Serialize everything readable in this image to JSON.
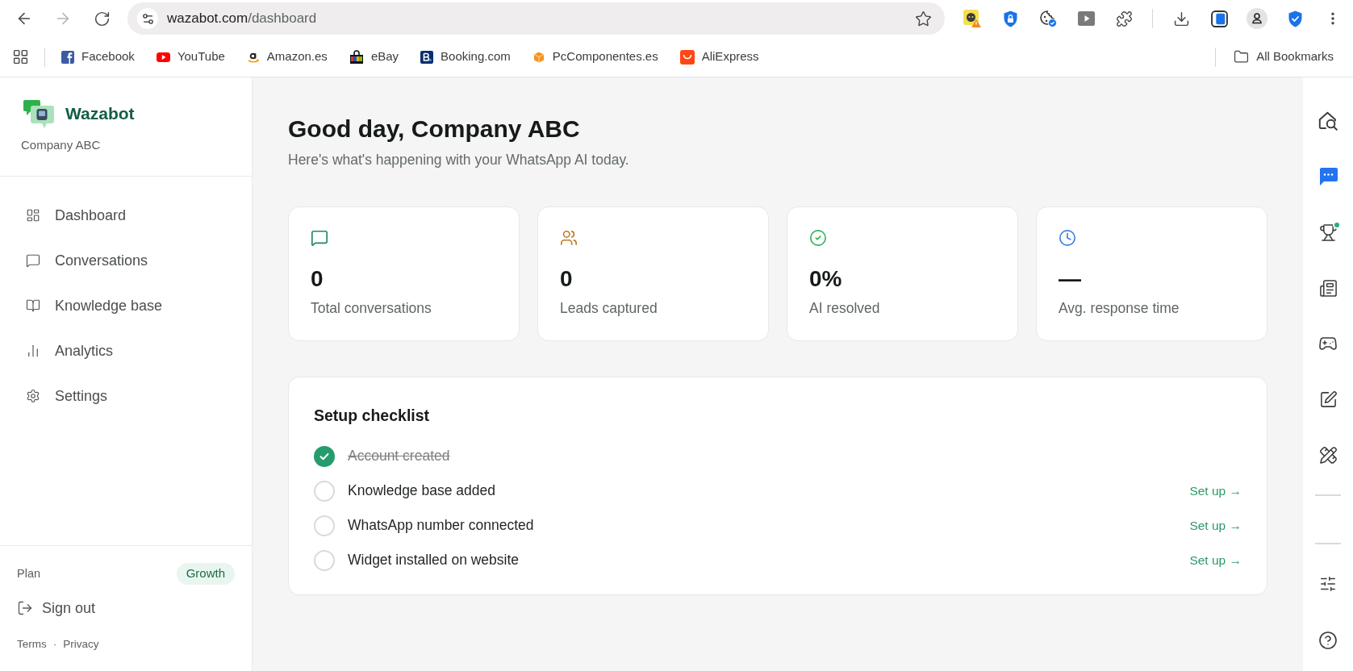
{
  "browser": {
    "forward_disabled": true,
    "url": {
      "host": "wazabot.com",
      "path": "/dashboard"
    },
    "bookmarks": [
      {
        "label": "Facebook",
        "kind": "fsquare"
      },
      {
        "label": "YouTube",
        "kind": "play"
      },
      {
        "label": "Amazon.es",
        "kind": "smile"
      },
      {
        "label": "eBay",
        "kind": "bag"
      },
      {
        "label": "Booking.com",
        "kind": "bsquare"
      },
      {
        "label": "PcComponentes.es",
        "kind": "cube"
      },
      {
        "label": "AliExpress",
        "kind": "tray"
      }
    ],
    "all_bookmarks": "All Bookmarks"
  },
  "sidebar": {
    "brand": "Wazabot",
    "company": "Company ABC",
    "nav": [
      {
        "label": "Dashboard",
        "kind": "grid"
      },
      {
        "label": "Conversations",
        "kind": "chat"
      },
      {
        "label": "Knowledge base",
        "kind": "book"
      },
      {
        "label": "Analytics",
        "kind": "bars"
      },
      {
        "label": "Settings",
        "kind": "gear"
      }
    ],
    "plan": {
      "label": "Plan",
      "value": "Growth"
    },
    "sign_out": "Sign out",
    "footer": {
      "links": [
        "Terms",
        "Privacy"
      ],
      "separator": "·"
    }
  },
  "header": {
    "title": "Good day, Company ABC",
    "subtitle": "Here's what's happening with your WhatsApp AI today."
  },
  "stats": [
    {
      "kind": "chat",
      "value": "0",
      "label": "Total conversations",
      "color": "#1f8a5e"
    },
    {
      "kind": "users",
      "value": "0",
      "label": "Leads captured",
      "color": "#c27a24"
    },
    {
      "kind": "check",
      "value": "0%",
      "label": "AI resolved",
      "color": "#2fb558"
    },
    {
      "kind": "clock",
      "value": "—",
      "label": "Avg. response time",
      "color": "#3b7fd9"
    }
  ],
  "checklist": {
    "title": "Setup checklist",
    "items": [
      {
        "label": "Account created",
        "done": true
      },
      {
        "label": "Knowledge base added",
        "done": false,
        "action": "Set up →"
      },
      {
        "label": "WhatsApp number connected",
        "done": false,
        "action": "Set up →"
      },
      {
        "label": "Widget installed on website",
        "done": false,
        "action": "Set up →"
      }
    ]
  }
}
